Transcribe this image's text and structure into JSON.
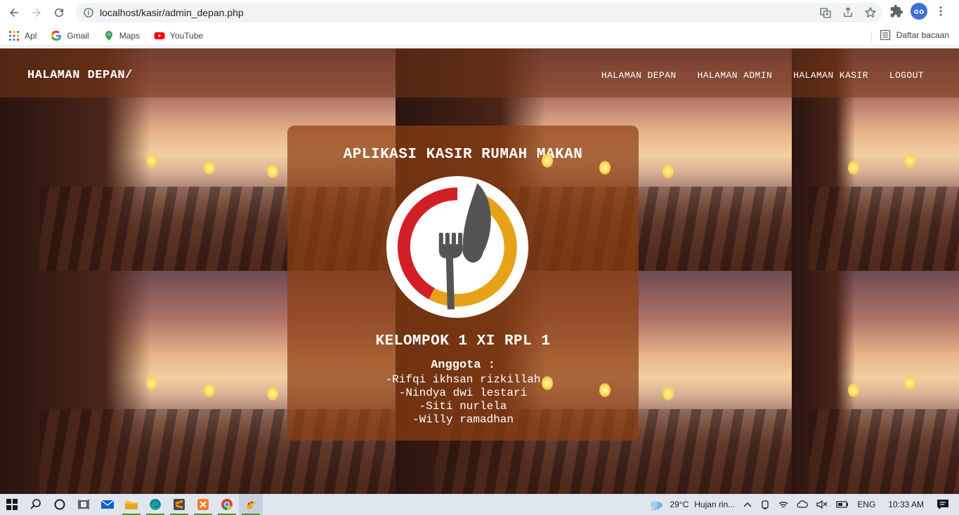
{
  "browser": {
    "url": "localhost/kasir/admin_depan.php",
    "bookmarks": [
      "Apl",
      "Gmail",
      "Maps",
      "YouTube"
    ],
    "reading_list": "Daftar bacaan",
    "icons": [
      "back-icon",
      "forward-icon",
      "reload-icon",
      "info-icon",
      "translate-icon",
      "share-icon",
      "star-icon",
      "extensions-icon",
      "profile-icon",
      "menu-icon"
    ]
  },
  "page": {
    "brand": "HALAMAN DEPAN/",
    "nav": [
      {
        "label": "HALAMAN DEPAN"
      },
      {
        "label": "HALAMAN ADMIN"
      },
      {
        "label": "HALAMAN KASIR"
      },
      {
        "label": "LOGOUT"
      }
    ],
    "card": {
      "title": "APLIKASI KASIR RUMAH MAKAN",
      "group": "KELOMPOK 1 XI RPL 1",
      "members_heading": "Anggota :",
      "members": [
        "-Rifqi ikhsan rizkillah",
        "-Nindya dwi lestari",
        "-Siti nurlela",
        "-Willy ramadhan"
      ]
    },
    "colors": {
      "nav_bg": "#78371480",
      "card_bg": "#8c3e12",
      "logo_red": "#d21f26",
      "logo_gold": "#e8a219",
      "logo_grey": "#545454"
    }
  },
  "taskbar": {
    "weather_temp": "29°C",
    "weather_text": "Hujan rin...",
    "language": "ENG",
    "time": "10:33 AM"
  }
}
